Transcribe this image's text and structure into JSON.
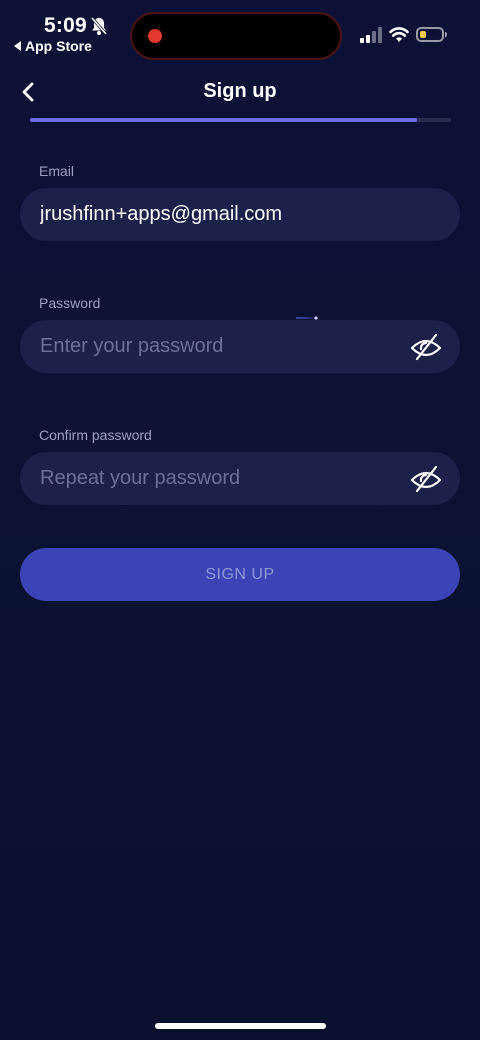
{
  "status_bar": {
    "time": "5:09",
    "back_app_label": "App Store",
    "battery_color": "#f2c94c",
    "recording_color": "#e5392f"
  },
  "header": {
    "title": "Sign up",
    "progress_fraction": 0.92,
    "progress_color": "#6d6cf2"
  },
  "form": {
    "email": {
      "label": "Email",
      "value": "jrushfinn+apps@gmail.com",
      "placeholder": ""
    },
    "password": {
      "label": "Password",
      "value": "",
      "placeholder": "Enter your password",
      "toggle_icon": "eye-off-icon"
    },
    "confirm_password": {
      "label": "Confirm password",
      "value": "",
      "placeholder": "Repeat your password",
      "toggle_icon": "eye-off-icon"
    },
    "submit_label": "SIGN UP",
    "submit_color": "#3a44b4"
  }
}
